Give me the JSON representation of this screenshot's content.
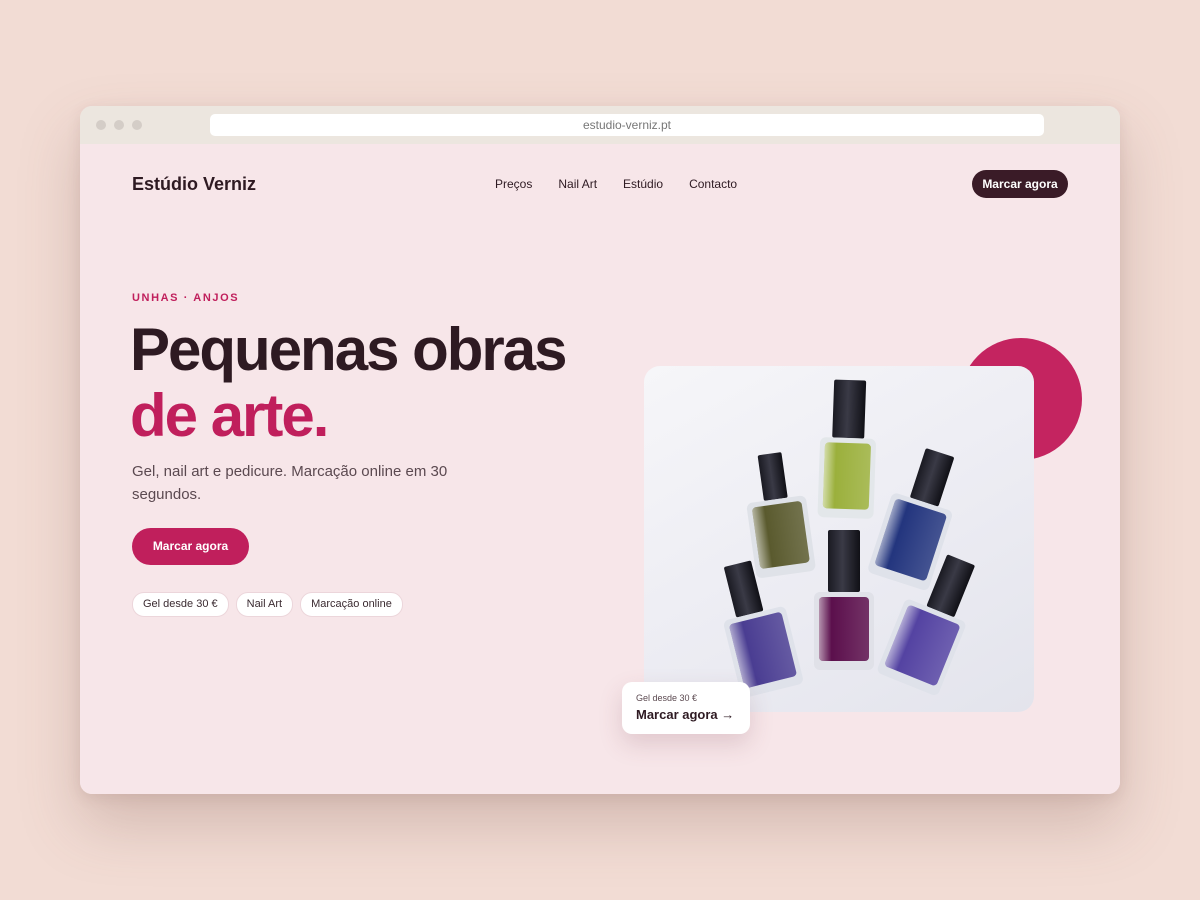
{
  "browser": {
    "url": "estudio-verniz.pt"
  },
  "header": {
    "logo": "Estúdio Verniz",
    "nav": [
      {
        "label": "Preços"
      },
      {
        "label": "Nail Art"
      },
      {
        "label": "Estúdio"
      },
      {
        "label": "Contacto"
      }
    ],
    "cta": "Marcar agora"
  },
  "hero": {
    "eyebrow": "UNHAS · ANJOS",
    "title_line1": "Pequenas obras",
    "title_line2": "de arte.",
    "subtitle": "Gel, nail art e pedicure. Marcação online em 30 segundos.",
    "cta": "Marcar agora",
    "chips": [
      {
        "label": "Gel desde 30 €"
      },
      {
        "label": "Nail Art"
      },
      {
        "label": "Marcação online"
      }
    ]
  },
  "floating_card": {
    "price": "Gel desde 30 €",
    "link": "Marcar agora →"
  },
  "colors": {
    "accent": "#c01f5c",
    "dark": "#3a1b27",
    "page_background": "#f7e6e9",
    "outer_background": "#f2dcd4"
  },
  "image": {
    "name": "nail-polish-bottles-photo",
    "bottles": [
      {
        "name": "olive-bottle",
        "color": "#5a5a2e"
      },
      {
        "name": "lime-bottle",
        "color": "#9bb03c"
      },
      {
        "name": "navy-glitter-bottle",
        "color": "#23357e"
      },
      {
        "name": "violet-bottle",
        "color": "#4a3d92"
      },
      {
        "name": "magenta-bottle",
        "color": "#5b0f4c"
      },
      {
        "name": "lavender-bottle",
        "color": "#5443a2"
      }
    ]
  }
}
